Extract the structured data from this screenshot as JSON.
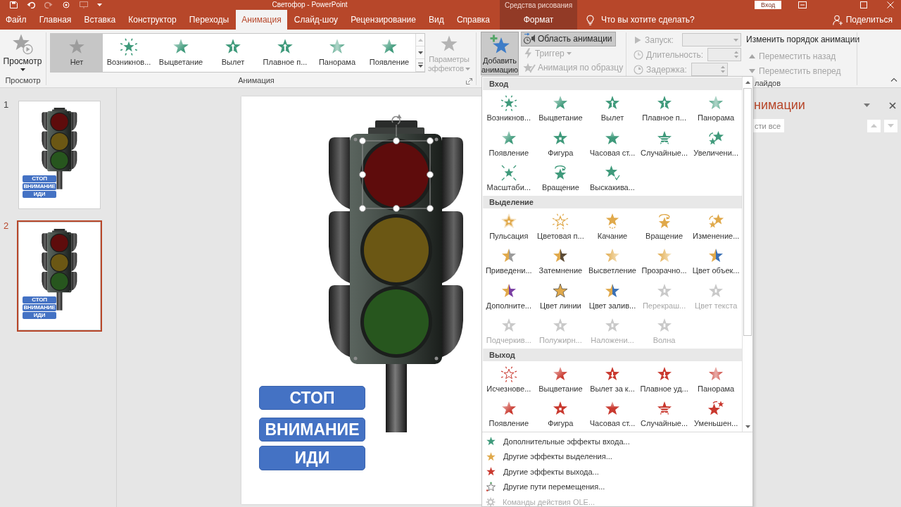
{
  "title_bar": {
    "title": "Светофор - PowerPoint",
    "context_label": "Средства рисования",
    "sign_in": "Вход"
  },
  "tabs": [
    {
      "label": "Файл",
      "selected": false,
      "kind": "normal"
    },
    {
      "label": "Главная",
      "selected": false,
      "kind": "normal"
    },
    {
      "label": "Вставка",
      "selected": false,
      "kind": "normal"
    },
    {
      "label": "Конструктор",
      "selected": false,
      "kind": "normal"
    },
    {
      "label": "Переходы",
      "selected": false,
      "kind": "normal"
    },
    {
      "label": "Анимация",
      "selected": true,
      "kind": "normal"
    },
    {
      "label": "Слайд-шоу",
      "selected": false,
      "kind": "normal"
    },
    {
      "label": "Рецензирование",
      "selected": false,
      "kind": "normal"
    },
    {
      "label": "Вид",
      "selected": false,
      "kind": "normal"
    },
    {
      "label": "Справка",
      "selected": false,
      "kind": "normal"
    },
    {
      "label": "Формат",
      "selected": false,
      "kind": "contextual"
    }
  ],
  "tell_me": {
    "placeholder": "Что вы хотите сделать?"
  },
  "share": {
    "label": "Поделиться"
  },
  "ribbon": {
    "preview": {
      "button": "Просмотр",
      "group_label": "Просмотр"
    },
    "animation": {
      "gallery": [
        {
          "label": "Нет",
          "selected": true,
          "kind": "none"
        },
        {
          "label": "Возникнов...",
          "selected": false,
          "kind": "entrance"
        },
        {
          "label": "Выцветание",
          "selected": false,
          "kind": "entrance"
        },
        {
          "label": "Вылет",
          "selected": false,
          "kind": "entrance"
        },
        {
          "label": "Плавное п...",
          "selected": false,
          "kind": "entrance"
        },
        {
          "label": "Панорама",
          "selected": false,
          "kind": "entrance"
        },
        {
          "label": "Появление",
          "selected": false,
          "kind": "entrance"
        }
      ],
      "effect_options": {
        "label": "Параметры эффектов",
        "disabled": true
      },
      "group_label": "Анимация"
    },
    "advanced": {
      "add_animation": {
        "label": "Добавить анимацию",
        "pressed": true
      },
      "commands": [
        {
          "label": "Область анимации",
          "pressed": true,
          "disabled": false,
          "dropdown": false
        },
        {
          "label": "Триггер",
          "pressed": false,
          "disabled": true,
          "dropdown": true
        },
        {
          "label": "Анимация по образцу",
          "pressed": false,
          "disabled": true,
          "dropdown": false
        }
      ]
    },
    "timing": {
      "fields": [
        {
          "label": "Запуск:",
          "kind": "combo",
          "disabled": true
        },
        {
          "label": "Длительность:",
          "kind": "spinner",
          "disabled": true
        },
        {
          "label": "Задержка:",
          "kind": "spinner",
          "disabled": true
        }
      ],
      "reorder_title": "Изменить порядок анимации",
      "reorder": [
        {
          "label": "Переместить назад",
          "kind": "up",
          "disabled": true
        },
        {
          "label": "Переместить вперед",
          "kind": "down",
          "disabled": true
        }
      ],
      "group_label": "лайдов"
    }
  },
  "slides": [
    {
      "number": "1",
      "selected": false,
      "labels": [
        "СТОП",
        "ВНИМАНИЕ",
        "ИДИ"
      ]
    },
    {
      "number": "2",
      "selected": true,
      "labels": [
        "СТОП",
        "ВНИМАНИЕ",
        "ИДИ"
      ]
    }
  ],
  "slide": {
    "lamps": [
      {
        "color": "#5e0c0c",
        "selected": true
      },
      {
        "color": "#6b5714",
        "selected": false
      },
      {
        "color": "#27561e",
        "selected": false
      }
    ],
    "labels": [
      "СТОП",
      "ВНИМАНИЕ",
      "ИДИ"
    ]
  },
  "animation_pane": {
    "title": "нимации",
    "play_all": "сти все"
  },
  "animation_menu": {
    "sections": [
      {
        "title": "Вход",
        "kind": "entrance",
        "items": [
          {
            "label": "Возникнов...",
            "disabled": false
          },
          {
            "label": "Выцветание",
            "disabled": false
          },
          {
            "label": "Вылет",
            "disabled": false
          },
          {
            "label": "Плавное п...",
            "disabled": false
          },
          {
            "label": "Панорама",
            "disabled": false
          },
          {
            "label": "Появление",
            "disabled": false
          },
          {
            "label": "Фигура",
            "disabled": false
          },
          {
            "label": "Часовая ст...",
            "disabled": false
          },
          {
            "label": "Случайные...",
            "disabled": false
          },
          {
            "label": "Увеличени...",
            "disabled": false
          },
          {
            "label": "Масштаби...",
            "disabled": false
          },
          {
            "label": "Вращение",
            "disabled": false
          },
          {
            "label": "Выскакива...",
            "disabled": false
          }
        ]
      },
      {
        "title": "Выделение",
        "kind": "emphasis",
        "items": [
          {
            "label": "Пульсация",
            "disabled": false
          },
          {
            "label": "Цветовая п...",
            "disabled": false
          },
          {
            "label": "Качание",
            "disabled": false
          },
          {
            "label": "Вращение",
            "disabled": false
          },
          {
            "label": "Изменение...",
            "disabled": false
          },
          {
            "label": "Приведени...",
            "disabled": false
          },
          {
            "label": "Затемнение",
            "disabled": false
          },
          {
            "label": "Высветление",
            "disabled": false
          },
          {
            "label": "Прозрачно...",
            "disabled": false
          },
          {
            "label": "Цвет объек...",
            "disabled": false
          },
          {
            "label": "Дополните...",
            "disabled": false
          },
          {
            "label": "Цвет линии",
            "disabled": false
          },
          {
            "label": "Цвет залив...",
            "disabled": false
          },
          {
            "label": "Перекраш...",
            "disabled": true
          },
          {
            "label": "Цвет текста",
            "disabled": true
          },
          {
            "label": "Подчеркив...",
            "disabled": true
          },
          {
            "label": "Полужирн...",
            "disabled": true
          },
          {
            "label": "Наложени...",
            "disabled": true
          },
          {
            "label": "Волна",
            "disabled": true
          }
        ]
      },
      {
        "title": "Выход",
        "kind": "exit",
        "items": [
          {
            "label": "Исчезнове...",
            "disabled": false
          },
          {
            "label": "Выцветание",
            "disabled": false
          },
          {
            "label": "Вылет за к...",
            "disabled": false
          },
          {
            "label": "Плавное уд...",
            "disabled": false
          },
          {
            "label": "Панорама",
            "disabled": false
          },
          {
            "label": "Появление",
            "disabled": false
          },
          {
            "label": "Фигура",
            "disabled": false
          },
          {
            "label": "Часовая ст...",
            "disabled": false
          },
          {
            "label": "Случайные...",
            "disabled": false
          },
          {
            "label": "Уменьшен...",
            "disabled": false
          }
        ]
      }
    ],
    "commands": [
      {
        "label": "Дополнительные эффекты входа...",
        "kind": "entrance",
        "disabled": false
      },
      {
        "label": "Другие эффекты выделения...",
        "kind": "emphasis",
        "disabled": false
      },
      {
        "label": "Другие эффекты выхода...",
        "kind": "exit",
        "disabled": false
      },
      {
        "label": "Другие пути перемещения...",
        "kind": "path",
        "disabled": false
      },
      {
        "label": "Команды действия OLE...",
        "kind": "ole",
        "disabled": true
      }
    ]
  }
}
